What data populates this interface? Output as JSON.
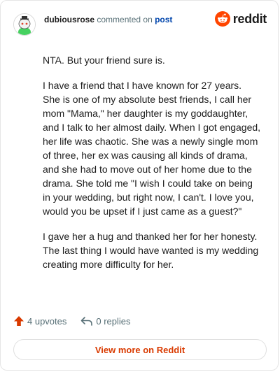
{
  "header": {
    "username": "dubiousrose",
    "action_text": "commented on",
    "post_link": "post",
    "brand_name": "reddit"
  },
  "comment": {
    "paragraphs": [
      "NTA. But your friend sure is.",
      "I have a friend that I have known for 27 years. She is one of my absolute best friends, I call her mom \"Mama,\" her daughter is my goddaughter, and I talk to her almost daily. When I got engaged, her life was chaotic. She was a newly single mom of three, her ex was causing all kinds of drama, and she had to move out of her home due to the drama. She told me \"I wish I could take on being in your wedding, but right now, I can't. I love you, would you be upset if I just came as a guest?\"",
      "I gave her a hug and thanked her for her honesty. The last thing I would have wanted is my wedding creating more difficulty for her."
    ]
  },
  "footer": {
    "upvotes": "4 upvotes",
    "replies": "0 replies",
    "view_more": "View more on Reddit"
  },
  "colors": {
    "brand_orange": "#ff4500",
    "link_blue": "#0045ac",
    "view_more_text": "#d93a00",
    "upvote_icon": "#d93a00"
  },
  "icons": {
    "avatar": "snoo-avatar",
    "brand": "reddit-logo-icon",
    "upvote": "upvote-arrow-icon",
    "reply": "reply-arrow-icon"
  }
}
